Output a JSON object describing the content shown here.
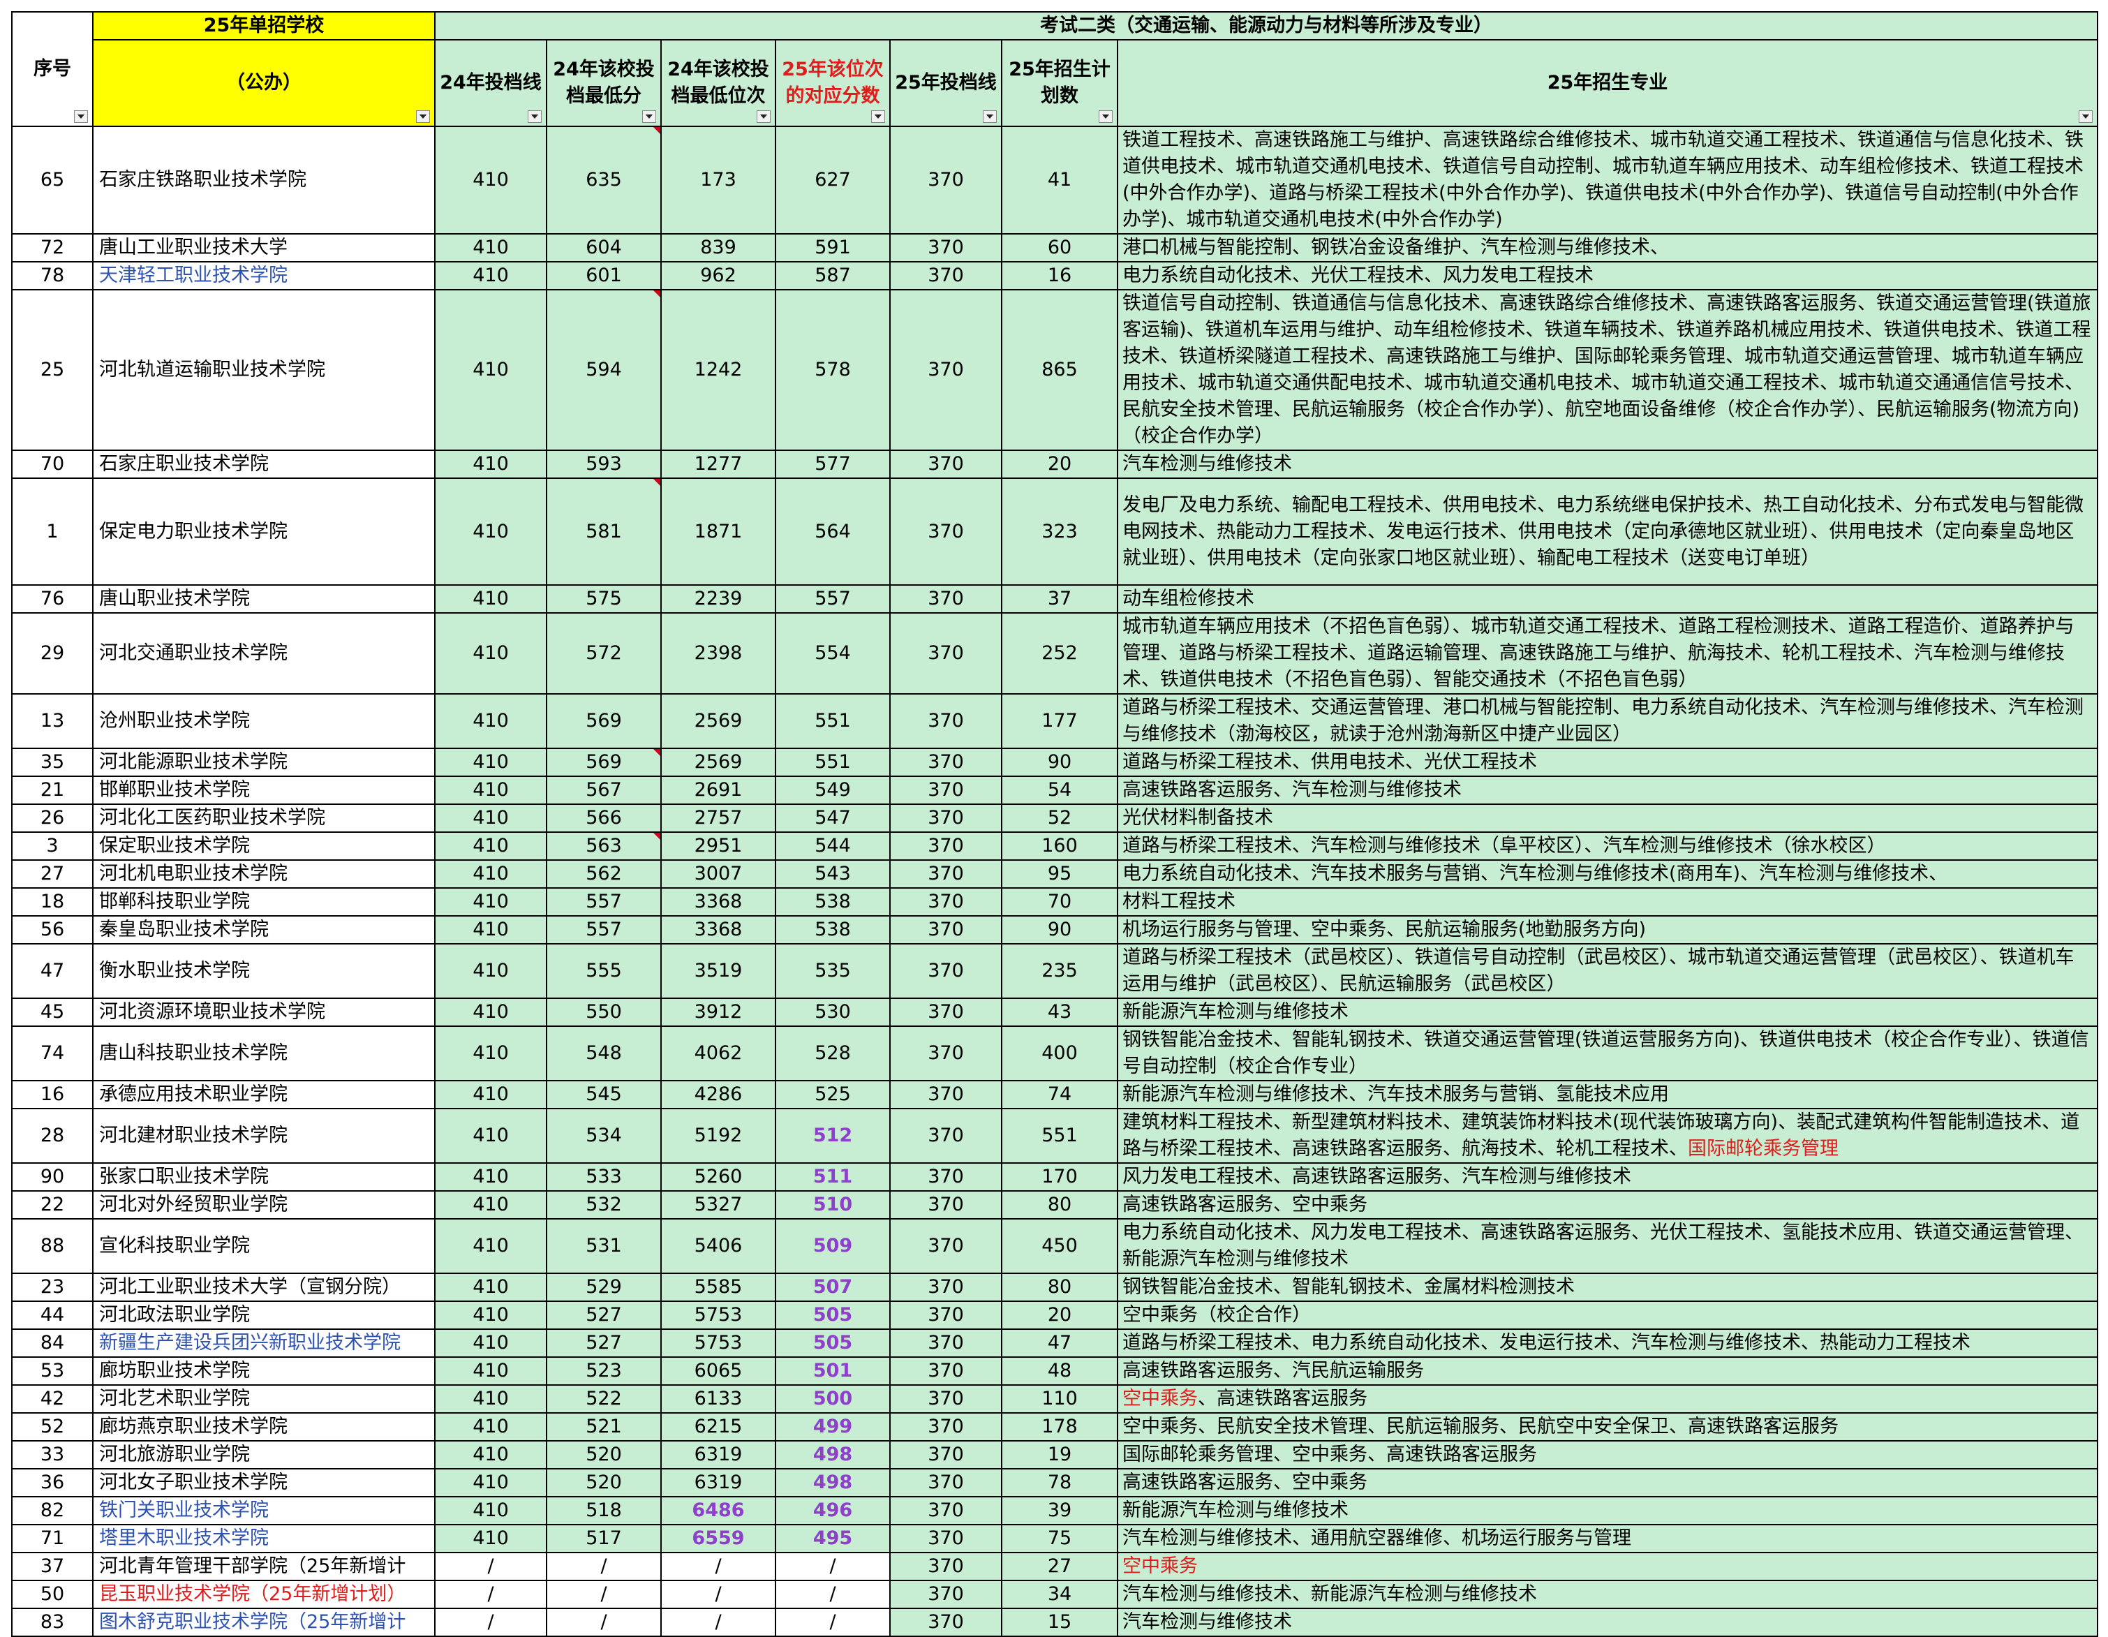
{
  "header": {
    "top_left": "25年单招学校",
    "top_right": "考试二类（交通运输、能源动力与材料等所涉及专业）",
    "col_seq": "序号",
    "col_school": "（公办）",
    "col_line24": "24年投档线",
    "col_min24": "24年该校投档最低分",
    "col_rank24": "24年该校投档最低位次",
    "col_score25": "25年该位次的对应分数",
    "col_line25": "25年投档线",
    "col_plan25": "25年招生计划数",
    "col_majors": "25年招生专业"
  },
  "rows": [
    {
      "seq": "65",
      "school": "石家庄铁路职业技术学院",
      "line24": "410",
      "min24": "635",
      "rank24": "173",
      "score25": "627",
      "line25": "370",
      "plan": "41",
      "majors": "铁道工程技术、高速铁路施工与维护、高速铁路综合维修技术、城市轨道交通工程技术、铁道通信与信息化技术、铁道供电技术、城市轨道交通机电技术、铁道信号自动控制、城市轨道车辆应用技术、动车组检修技术、铁道工程技术(中外合作办学)、道路与桥梁工程技术(中外合作办学)、铁道供电技术(中外合作办学)、铁道信号自动控制(中外合作办学)、城市轨道交通机电技术(中外合作办学)"
    },
    {
      "seq": "72",
      "school": "唐山工业职业技术大学",
      "line24": "410",
      "min24": "604",
      "rank24": "839",
      "score25": "591",
      "line25": "370",
      "plan": "60",
      "majors": "港口机械与智能控制、钢铁冶金设备维护、汽车检测与维修技术、"
    },
    {
      "seq": "78",
      "school": "天津轻工职业技术学院",
      "line24": "410",
      "min24": "601",
      "rank24": "962",
      "score25": "587",
      "line25": "370",
      "plan": "16",
      "majors": "电力系统自动化技术、光伏工程技术、风力发电工程技术"
    },
    {
      "seq": "25",
      "school": "河北轨道运输职业技术学院",
      "line24": "410",
      "min24": "594",
      "rank24": "1242",
      "score25": "578",
      "line25": "370",
      "plan": "865",
      "majors": "铁道信号自动控制、铁道通信与信息化技术、高速铁路综合维修技术、高速铁路客运服务、铁道交通运营管理(铁道旅客运输)、铁道机车运用与维护、动车组检修技术、铁道车辆技术、铁道养路机械应用技术、铁道供电技术、铁道工程技术、铁道桥梁隧道工程技术、高速铁路施工与维护、国际邮轮乘务管理、城市轨道交通运营管理、城市轨道车辆应用技术、城市轨道交通供配电技术、城市轨道交通机电技术、城市轨道交通工程技术、城市轨道交通通信信号技术、民航安全技术管理、民航运输服务（校企合作办学）、航空地面设备维修（校企合作办学）、民航运输服务(物流方向)（校企合作办学）"
    },
    {
      "seq": "70",
      "school": "石家庄职业技术学院",
      "line24": "410",
      "min24": "593",
      "rank24": "1277",
      "score25": "577",
      "line25": "370",
      "plan": "20",
      "majors": "汽车检测与维修技术"
    },
    {
      "seq": "1",
      "school": "保定电力职业技术学院",
      "line24": "410",
      "min24": "581",
      "rank24": "1871",
      "score25": "564",
      "line25": "370",
      "plan": "323",
      "majors": "发电厂及电力系统、输配电工程技术、供用电技术、电力系统继电保护技术、热工自动化技术、分布式发电与智能微电网技术、热能动力工程技术、发电运行技术、供用电技术（定向承德地区就业班）、供用电技术（定向秦皇岛地区就业班）、供用电技术（定向张家口地区就业班）、输配电工程技术（送变电订单班）"
    },
    {
      "seq": "76",
      "school": "唐山职业技术学院",
      "line24": "410",
      "min24": "575",
      "rank24": "2239",
      "score25": "557",
      "line25": "370",
      "plan": "37",
      "majors": "动车组检修技术"
    },
    {
      "seq": "29",
      "school": "河北交通职业技术学院",
      "line24": "410",
      "min24": "572",
      "rank24": "2398",
      "score25": "554",
      "line25": "370",
      "plan": "252",
      "majors": "城市轨道车辆应用技术（不招色盲色弱）、城市轨道交通工程技术、道路工程检测技术、道路工程造价、道路养护与管理、道路与桥梁工程技术、道路运输管理、高速铁路施工与维护、航海技术、轮机工程技术、汽车检测与维修技术、铁道供电技术（不招色盲色弱）、智能交通技术（不招色盲色弱）"
    },
    {
      "seq": "13",
      "school": "沧州职业技术学院",
      "line24": "410",
      "min24": "569",
      "rank24": "2569",
      "score25": "551",
      "line25": "370",
      "plan": "177",
      "majors": "道路与桥梁工程技术、交通运营管理、港口机械与智能控制、电力系统自动化技术、汽车检测与维修技术、汽车检测与维修技术（渤海校区，就读于沧州渤海新区中捷产业园区）"
    },
    {
      "seq": "35",
      "school": "河北能源职业技术学院",
      "line24": "410",
      "min24": "569",
      "rank24": "2569",
      "score25": "551",
      "line25": "370",
      "plan": "90",
      "majors": "道路与桥梁工程技术、供用电技术、光伏工程技术"
    },
    {
      "seq": "21",
      "school": "邯郸职业技术学院",
      "line24": "410",
      "min24": "567",
      "rank24": "2691",
      "score25": "549",
      "line25": "370",
      "plan": "54",
      "majors": "高速铁路客运服务、汽车检测与维修技术"
    },
    {
      "seq": "26",
      "school": "河北化工医药职业技术学院",
      "line24": "410",
      "min24": "566",
      "rank24": "2757",
      "score25": "547",
      "line25": "370",
      "plan": "52",
      "majors": "光伏材料制备技术"
    },
    {
      "seq": "3",
      "school": "保定职业技术学院",
      "line24": "410",
      "min24": "563",
      "rank24": "2951",
      "score25": "544",
      "line25": "370",
      "plan": "160",
      "majors": "道路与桥梁工程技术、汽车检测与维修技术（阜平校区）、汽车检测与维修技术（徐水校区）"
    },
    {
      "seq": "27",
      "school": "河北机电职业技术学院",
      "line24": "410",
      "min24": "562",
      "rank24": "3007",
      "score25": "543",
      "line25": "370",
      "plan": "95",
      "majors": "电力系统自动化技术、汽车技术服务与营销、汽车检测与维修技术(商用车)、汽车检测与维修技术、"
    },
    {
      "seq": "18",
      "school": "邯郸科技职业学院",
      "line24": "410",
      "min24": "557",
      "rank24": "3368",
      "score25": "538",
      "line25": "370",
      "plan": "70",
      "majors": "材料工程技术"
    },
    {
      "seq": "56",
      "school": "秦皇岛职业技术学院",
      "line24": "410",
      "min24": "557",
      "rank24": "3368",
      "score25": "538",
      "line25": "370",
      "plan": "90",
      "majors": "机场运行服务与管理、空中乘务、民航运输服务(地勤服务方向)"
    },
    {
      "seq": "47",
      "school": "衡水职业技术学院",
      "line24": "410",
      "min24": "555",
      "rank24": "3519",
      "score25": "535",
      "line25": "370",
      "plan": "235",
      "majors": "道路与桥梁工程技术（武邑校区）、铁道信号自动控制（武邑校区）、城市轨道交通运营管理（武邑校区）、铁道机车运用与维护（武邑校区）、民航运输服务（武邑校区）"
    },
    {
      "seq": "45",
      "school": "河北资源环境职业技术学院",
      "line24": "410",
      "min24": "550",
      "rank24": "3912",
      "score25": "530",
      "line25": "370",
      "plan": "43",
      "majors": "新能源汽车检测与维修技术"
    },
    {
      "seq": "74",
      "school": "唐山科技职业技术学院",
      "line24": "410",
      "min24": "548",
      "rank24": "4062",
      "score25": "528",
      "line25": "370",
      "plan": "400",
      "majors": "钢铁智能冶金技术、智能轧钢技术、铁道交通运营管理(铁道运营服务方向)、铁道供电技术（校企合作专业）、铁道信号自动控制（校企合作专业）"
    },
    {
      "seq": "16",
      "school": "承德应用技术职业学院",
      "line24": "410",
      "min24": "545",
      "rank24": "4286",
      "score25": "525",
      "line25": "370",
      "plan": "74",
      "majors": "新能源汽车检测与维修技术、汽车技术服务与营销、氢能技术应用"
    },
    {
      "seq": "28",
      "school": "河北建材职业技术学院",
      "line24": "410",
      "min24": "534",
      "rank24": "5192",
      "score25": "512",
      "line25": "370",
      "plan": "551",
      "majors": "建筑材料工程技术、新型建筑材料技术、建筑装饰材料技术(现代装饰玻璃方向)、装配式建筑构件智能制造技术、道路与桥梁工程技术、高速铁路客运服务、航海技术、轮机工程技术、",
      "majors_red": "国际邮轮乘务管理"
    },
    {
      "seq": "90",
      "school": "张家口职业技术学院",
      "line24": "410",
      "min24": "533",
      "rank24": "5260",
      "score25": "511",
      "line25": "370",
      "plan": "170",
      "majors": "风力发电工程技术、高速铁路客运服务、汽车检测与维修技术"
    },
    {
      "seq": "22",
      "school": "河北对外经贸职业学院",
      "line24": "410",
      "min24": "532",
      "rank24": "5327",
      "score25": "510",
      "line25": "370",
      "plan": "80",
      "majors": "高速铁路客运服务、空中乘务"
    },
    {
      "seq": "88",
      "school": "宣化科技职业学院",
      "line24": "410",
      "min24": "531",
      "rank24": "5406",
      "score25": "509",
      "line25": "370",
      "plan": "450",
      "majors": "电力系统自动化技术、风力发电工程技术、高速铁路客运服务、光伏工程技术、氢能技术应用、铁道交通运营管理、新能源汽车检测与维修技术"
    },
    {
      "seq": "23",
      "school": "河北工业职业技术大学（宣钢分院）",
      "line24": "410",
      "min24": "529",
      "rank24": "5585",
      "score25": "507",
      "line25": "370",
      "plan": "80",
      "majors": "钢铁智能冶金技术、智能轧钢技术、金属材料检测技术"
    },
    {
      "seq": "44",
      "school": "河北政法职业学院",
      "line24": "410",
      "min24": "527",
      "rank24": "5753",
      "score25": "505",
      "line25": "370",
      "plan": "20",
      "majors": "空中乘务（校企合作）"
    },
    {
      "seq": "84",
      "school": "新疆生产建设兵团兴新职业技术学院",
      "line24": "410",
      "min24": "527",
      "rank24": "5753",
      "score25": "505",
      "line25": "370",
      "plan": "47",
      "majors": "道路与桥梁工程技术、电力系统自动化技术、发电运行技术、汽车检测与维修技术、热能动力工程技术"
    },
    {
      "seq": "53",
      "school": "廊坊职业技术学院",
      "line24": "410",
      "min24": "523",
      "rank24": "6065",
      "score25": "501",
      "line25": "370",
      "plan": "48",
      "majors": "高速铁路客运服务、汽民航运输服务"
    },
    {
      "seq": "42",
      "school": "河北艺术职业学院",
      "line24": "410",
      "min24": "522",
      "rank24": "6133",
      "score25": "500",
      "line25": "370",
      "plan": "110",
      "majors_red": "空中乘务",
      "majors": "、高速铁路客运服务"
    },
    {
      "seq": "52",
      "school": "廊坊燕京职业技术学院",
      "line24": "410",
      "min24": "521",
      "rank24": "6215",
      "score25": "499",
      "line25": "370",
      "plan": "178",
      "majors": "空中乘务、民航安全技术管理、民航运输服务、民航空中安全保卫、高速铁路客运服务"
    },
    {
      "seq": "33",
      "school": "河北旅游职业学院",
      "line24": "410",
      "min24": "520",
      "rank24": "6319",
      "score25": "498",
      "line25": "370",
      "plan": "19",
      "majors": "国际邮轮乘务管理、空中乘务、高速铁路客运服务"
    },
    {
      "seq": "36",
      "school": "河北女子职业技术学院",
      "line24": "410",
      "min24": "520",
      "rank24": "6319",
      "score25": "498",
      "line25": "370",
      "plan": "78",
      "majors": "高速铁路客运服务、空中乘务"
    },
    {
      "seq": "82",
      "school": "铁门关职业技术学院",
      "line24": "410",
      "min24": "518",
      "rank24": "6486",
      "score25": "496",
      "line25": "370",
      "plan": "39",
      "majors": "新能源汽车检测与维修技术"
    },
    {
      "seq": "71",
      "school": "塔里木职业技术学院",
      "line24": "410",
      "min24": "517",
      "rank24": "6559",
      "score25": "495",
      "line25": "370",
      "plan": "75",
      "majors": "汽车检测与维修技术、通用航空器维修、机场运行服务与管理"
    },
    {
      "seq": "37",
      "school": "河北青年管理干部学院（25年新增计",
      "line24": "/",
      "min24": "/",
      "rank24": "/",
      "score25": "/",
      "line25": "370",
      "plan": "27",
      "majors_red": "空中乘务",
      "majors": ""
    },
    {
      "seq": "50",
      "school": "昆玉职业技术学院（25年新增计划）",
      "line24": "/",
      "min24": "/",
      "rank24": "/",
      "score25": "/",
      "line25": "370",
      "plan": "34",
      "majors": "汽车检测与维修技术、新能源汽车检测与维修技术"
    },
    {
      "seq": "83",
      "school": "图木舒克职业技术学院（25年新增计",
      "line24": "/",
      "min24": "/",
      "rank24": "/",
      "score25": "/",
      "line25": "370",
      "plan": "15",
      "majors": "汽车检测与维修技术"
    }
  ],
  "colors": {
    "yellow": "#ffff00",
    "green": "#c7edd3",
    "blue_text": "#2d52b0",
    "red_text": "#e11c1c",
    "purple_text": "#8e3fcb"
  }
}
